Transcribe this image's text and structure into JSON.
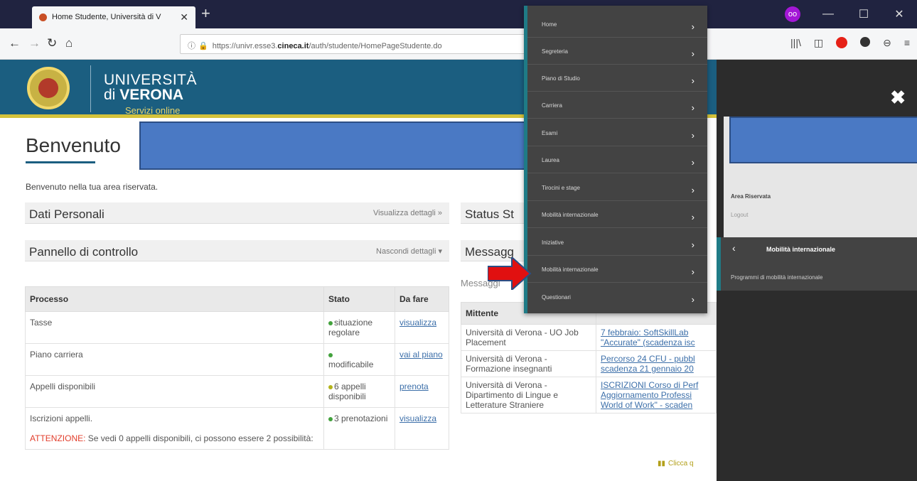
{
  "browser": {
    "tab_title": "Home Studente, Università di V",
    "url_prefix": "https://univr.esse3.",
    "url_domain": "cineca.it",
    "url_path": "/auth/studente/HomePageStudente.do"
  },
  "header": {
    "line1": "UNIVERSITÀ",
    "line2_prefix": "di",
    "line2_bold": "VERONA",
    "subtitle": "Servizi online"
  },
  "page": {
    "title": "Benvenuto",
    "subtitle": "Benvenuto nella tua area riservata."
  },
  "panels": {
    "dati_personali": {
      "title": "Dati Personali",
      "action": "Visualizza dettagli"
    },
    "pannello": {
      "title": "Pannello di controllo",
      "action": "Nascondi dettagli"
    },
    "status": {
      "title": "Status St"
    },
    "messaggi": {
      "title": "Messagg"
    }
  },
  "process_table": {
    "headers": [
      "Processo",
      "Stato",
      "Da fare"
    ],
    "rows": [
      {
        "processo": "Tasse",
        "stato": "situazione regolare",
        "azione": "visualizza"
      },
      {
        "processo": "Piano carriera",
        "stato": "modificabile",
        "azione": "vai al piano"
      },
      {
        "processo": "Appelli disponibili",
        "stato": "6 appelli disponibili",
        "azione": "prenota"
      },
      {
        "processo": "Iscrizioni appelli.",
        "stato": "3 prenotazioni",
        "azione": "visualizza"
      }
    ],
    "warning_label": "ATTENZIONE:",
    "warning_text": "Se vedi 0 appelli disponibili, ci possono essere 2 possibilità:"
  },
  "messages": {
    "label": "Messaggi",
    "header": "Mittente",
    "rows": [
      {
        "mittente": "Università di Verona - UO Job Placement",
        "line1": "7 febbraio: SoftSkillLab",
        "line2": "\"Accurate\" (scadenza isc"
      },
      {
        "mittente": "Università di Verona - Formazione insegnanti",
        "line1": "Percorso 24 CFU - pubbl",
        "line2": "scadenza 21 gennaio 20"
      },
      {
        "mittente": "Università di Verona - Dipartimento di Lingue e Letterature Straniere",
        "line1": "ISCRIZIONI Corso di Perf",
        "line2": "Aggiornamento Professi",
        "line3": "World of Work\" - scaden"
      }
    ],
    "link": "Clicca q"
  },
  "menu": {
    "items": [
      "Home",
      "Segreteria",
      "Piano di Studio",
      "Carriera",
      "Esami",
      "Laurea",
      "Tirocini e stage",
      "Mobilità internazionale",
      "Iniziative",
      "Mobilità internazionale",
      "Questionari"
    ]
  },
  "side": {
    "area": "Area Riservata",
    "logout": "Logout",
    "section": "Mobilità internazionale",
    "item": "Programmi di mobilità internazionale"
  },
  "colors": {
    "accent": "#1f7b86",
    "header": "#1b5e80",
    "redaction": "#4a79c4",
    "arrow": "#e11010"
  }
}
